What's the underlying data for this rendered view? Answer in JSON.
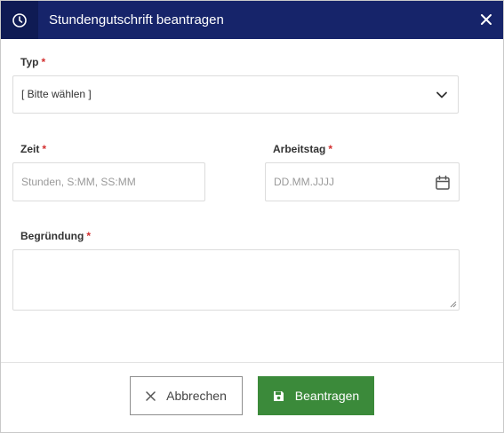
{
  "dialog": {
    "title": "Stundengutschrift beantragen",
    "title_icon": "clock-icon",
    "close_icon": "close-icon"
  },
  "form": {
    "type": {
      "label": "Typ",
      "required_marker": "*",
      "selected_value": "[ Bitte wählen ]",
      "icon": "chevron-down-icon"
    },
    "time": {
      "label": "Zeit",
      "required_marker": "*",
      "placeholder": "Stunden, S:MM, SS:MM"
    },
    "workday": {
      "label": "Arbeitstag",
      "required_marker": "*",
      "placeholder": "DD.MM.JJJJ",
      "icon": "calendar-icon"
    },
    "reason": {
      "label": "Begründung",
      "required_marker": "*",
      "value": ""
    }
  },
  "footer": {
    "cancel_label": "Abbrechen",
    "cancel_icon": "x-icon",
    "submit_label": "Beantragen",
    "submit_icon": "save-icon"
  },
  "colors": {
    "header_bg": "#16246a",
    "header_icon_bg": "#0f1b54",
    "required": "#d32f2f",
    "submit_bg": "#3b8a3a"
  }
}
